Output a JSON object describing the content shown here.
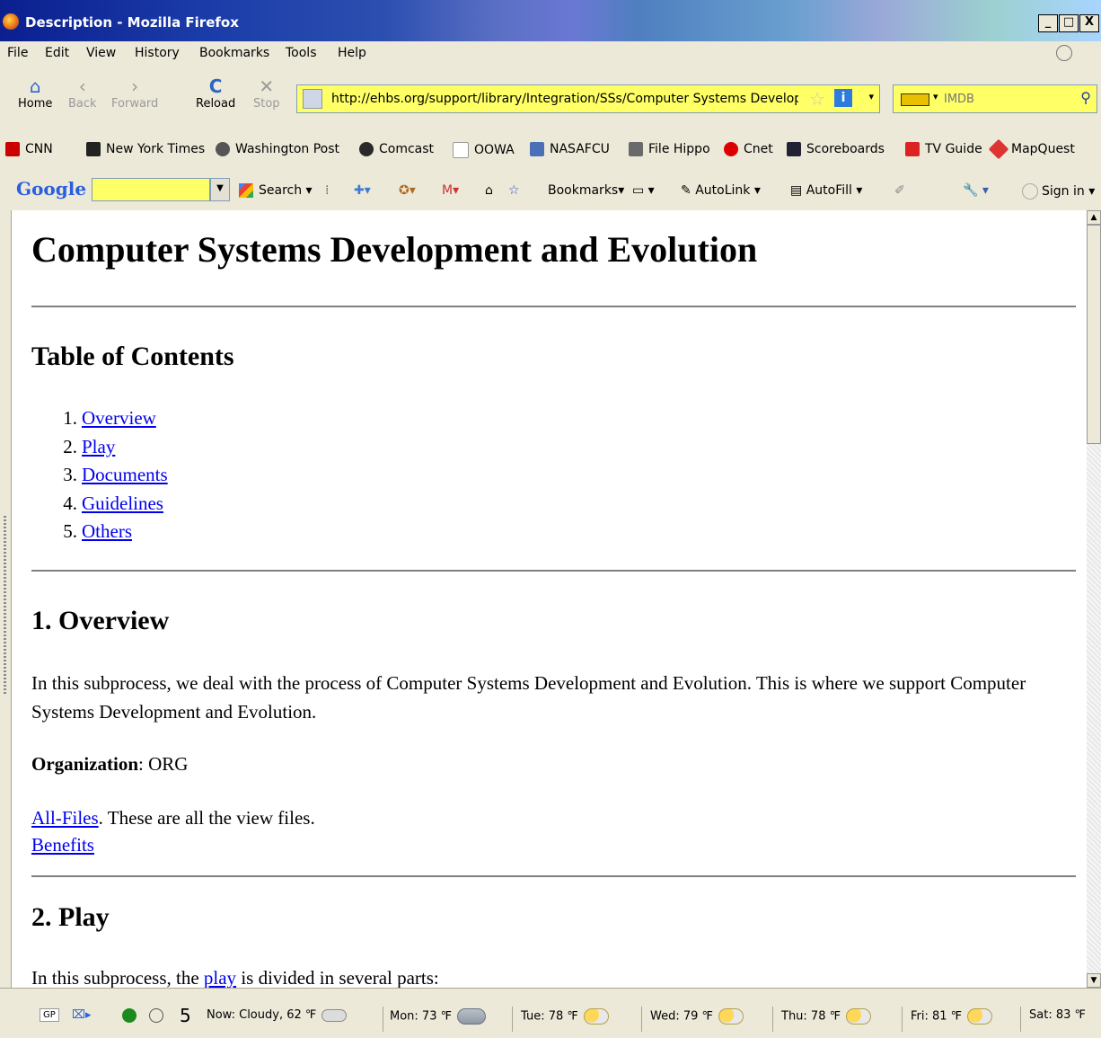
{
  "window": {
    "title": "Description - Mozilla Firefox",
    "controls": [
      "_",
      "□",
      "X"
    ]
  },
  "menu": [
    "File",
    "Edit",
    "View",
    "History",
    "Bookmarks",
    "Tools",
    "Help"
  ],
  "nav": {
    "home": "Home",
    "back": "Back",
    "forward": "Forward",
    "reload": "Reload",
    "stop": "Stop",
    "url": "http://ehbs.org/support/library/Integration/SSs/Computer Systems Developn",
    "search_placeholder": "IMDB"
  },
  "bookmarks": [
    "CNN",
    "New York Times",
    "Washington Post",
    "Comcast",
    "OOWA",
    "NASAFCU",
    "File Hippo",
    "Cnet",
    "Scoreboards",
    "TV Guide",
    "MapQuest"
  ],
  "google_toolbar": {
    "logo": "Google",
    "search": "Search",
    "bookmarks": "Bookmarks",
    "autolink": "AutoLink",
    "autofill": "AutoFill",
    "signin": "Sign in"
  },
  "page": {
    "title": "Computer Systems Development and Evolution",
    "toc_heading": "Table of Contents",
    "toc": [
      {
        "num": "1.",
        "label": "Overview"
      },
      {
        "num": "2.",
        "label": "Play"
      },
      {
        "num": "3.",
        "label": "Documents"
      },
      {
        "num": "4.",
        "label": "Guidelines"
      },
      {
        "num": "5.",
        "label": "Others"
      }
    ],
    "overview_heading": "1. Overview",
    "overview_text": "In this subprocess, we deal with the process of Computer Systems Development and Evolution. This is where we support Computer Systems Development and Evolution.",
    "organization_label": "Organization",
    "organization_value": ": ORG",
    "allfiles_link": "All-Files",
    "allfiles_text": ". These are all the view files.",
    "benefits_link": "Benefits",
    "play_heading": "2. Play",
    "play_text_pre": "In this subprocess, the ",
    "play_link": "play",
    "play_text_post": " is divided in several parts:"
  },
  "status": {
    "gp": "GP",
    "count": "5",
    "weather": [
      {
        "label": "Now: Cloudy, 62 ℉",
        "icon": "cloud"
      },
      {
        "label": "Mon: 73 ℉",
        "icon": "rain-cloud"
      },
      {
        "label": "Tue: 78 ℉",
        "icon": "sun-cloud"
      },
      {
        "label": "Wed: 79 ℉",
        "icon": "sun-cloud"
      },
      {
        "label": "Thu: 78 ℉",
        "icon": "sun-cloud"
      },
      {
        "label": "Fri: 81 ℉",
        "icon": "sun-cloud"
      },
      {
        "label": "Sat: 83 ℉",
        "icon": "none"
      }
    ]
  }
}
